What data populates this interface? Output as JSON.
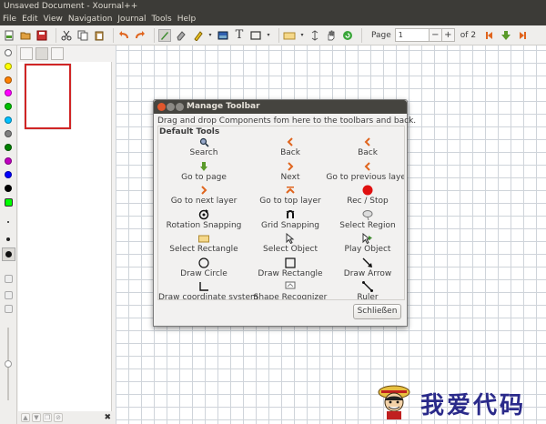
{
  "window": {
    "title": "Unsaved Document - Xournal++"
  },
  "menu": [
    "File",
    "Edit",
    "View",
    "Navigation",
    "Journal",
    "Tools",
    "Help"
  ],
  "toolbar": {
    "page_label": "Page",
    "page_value": "1",
    "minus": "−",
    "plus": "+",
    "of_label": "of 2",
    "text_tool": "T"
  },
  "colors": [
    "#ffffff",
    "#ffff00",
    "#ff8000",
    "#ff00ff",
    "#00c000",
    "#00c0ff",
    "#808080",
    "#008000",
    "#c000c0",
    "#0000ff",
    "#000000",
    "#00ff00"
  ],
  "dialog": {
    "title": "Manage Toolbar",
    "hint": "Drag and drop Components fom here to the toolbars and back.",
    "section": "Default Tools",
    "items": [
      {
        "label": "Search",
        "icon": "search-icon"
      },
      {
        "label": "Back",
        "icon": "back-arrow-icon"
      },
      {
        "label": "Back",
        "icon": "back-arrow-icon"
      },
      {
        "label": "Go to page",
        "icon": "goto-page-icon"
      },
      {
        "label": "Next",
        "icon": "next-arrow-icon"
      },
      {
        "label": "Go to previous layer",
        "icon": "previous-layer-icon"
      },
      {
        "label": "Go to next layer",
        "icon": "next-layer-icon"
      },
      {
        "label": "Go to top layer",
        "icon": "top-layer-icon"
      },
      {
        "label": "Rec / Stop",
        "icon": "record-icon"
      },
      {
        "label": "Rotation Snapping",
        "icon": "rotation-snapping-icon"
      },
      {
        "label": "Grid Snapping",
        "icon": "grid-snapping-icon"
      },
      {
        "label": "Select Region",
        "icon": "select-region-icon"
      },
      {
        "label": "Select Rectangle",
        "icon": "select-rectangle-icon"
      },
      {
        "label": "Select Object",
        "icon": "select-object-icon"
      },
      {
        "label": "Play Object",
        "icon": "play-object-icon"
      },
      {
        "label": "Draw Circle",
        "icon": "draw-circle-icon"
      },
      {
        "label": "Draw Rectangle",
        "icon": "draw-rectangle-icon"
      },
      {
        "label": "Draw Arrow",
        "icon": "draw-arrow-icon"
      },
      {
        "label": "Draw coordinate system",
        "icon": "coordinate-system-icon"
      },
      {
        "label": "Shape Recognizer",
        "icon": "shape-recognizer-icon"
      },
      {
        "label": "Ruler",
        "icon": "ruler-icon"
      }
    ],
    "close_label": "Schließen"
  },
  "watermark": {
    "text": "我爱代码"
  }
}
